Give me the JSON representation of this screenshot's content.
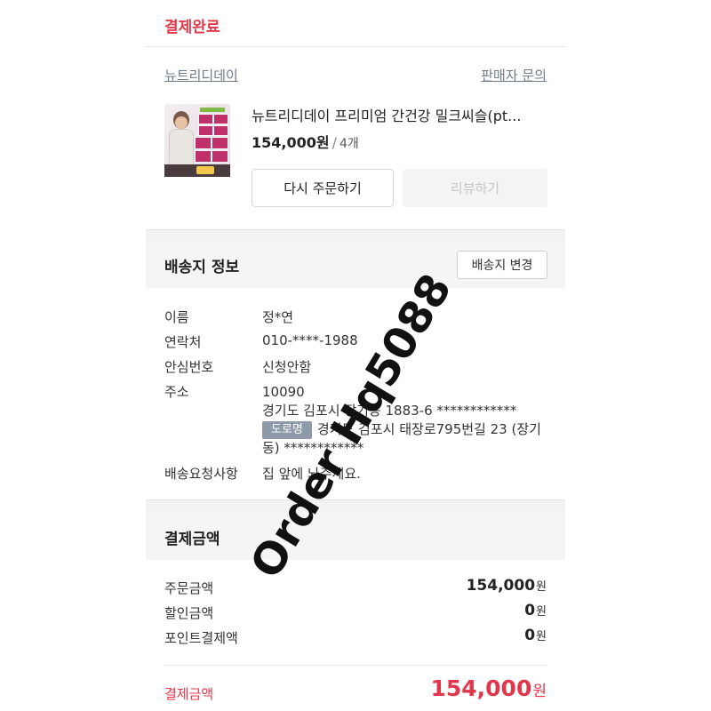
{
  "order": {
    "status_label": "결제완료",
    "seller_name": "뉴트리디데이",
    "seller_inquiry": "판매자 문의",
    "product_name": "뉴트리디데이 프리미엄 간건강 밀크씨슬(pt...",
    "price": "154,000원",
    "separator": "/",
    "quantity": "4개",
    "reorder_button": "다시 주문하기",
    "review_button": "리뷰하기"
  },
  "shipping": {
    "title": "배송지 정보",
    "change_button": "배송지 변경",
    "name_label": "이름",
    "name_value": "정*연",
    "contact_label": "연락처",
    "contact_value": "010-****-1988",
    "safe_number_label": "안심번호",
    "safe_number_value": "신청안함",
    "address_label": "주소",
    "postal_code": "10090",
    "jibun_address": "경기도 김포시 장기동 1883-6 ************",
    "road_badge": "도로명",
    "road_address": "경기도 김포시 태장로795번길 23 (장기동) ************",
    "request_label": "배송요청사항",
    "request_value": "집 앞에 놔주세요."
  },
  "payment": {
    "title": "결제금액",
    "order_amount_label": "주문금액",
    "order_amount_value": "154,000",
    "discount_label": "할인금액",
    "discount_value": "0",
    "point_label": "포인트결제액",
    "point_value": "0",
    "unit": "원",
    "total_label": "결제금액",
    "total_value": "154,000"
  },
  "watermark": "Order Hq5088",
  "colors": {
    "accent_red": "#e0384a",
    "link_gray": "#6f7c8c",
    "badge_gray": "#8e9aa9",
    "section_bg": "#f5f5f5"
  },
  "icons": {
    "product_thumbnail": "product-image-icon"
  }
}
